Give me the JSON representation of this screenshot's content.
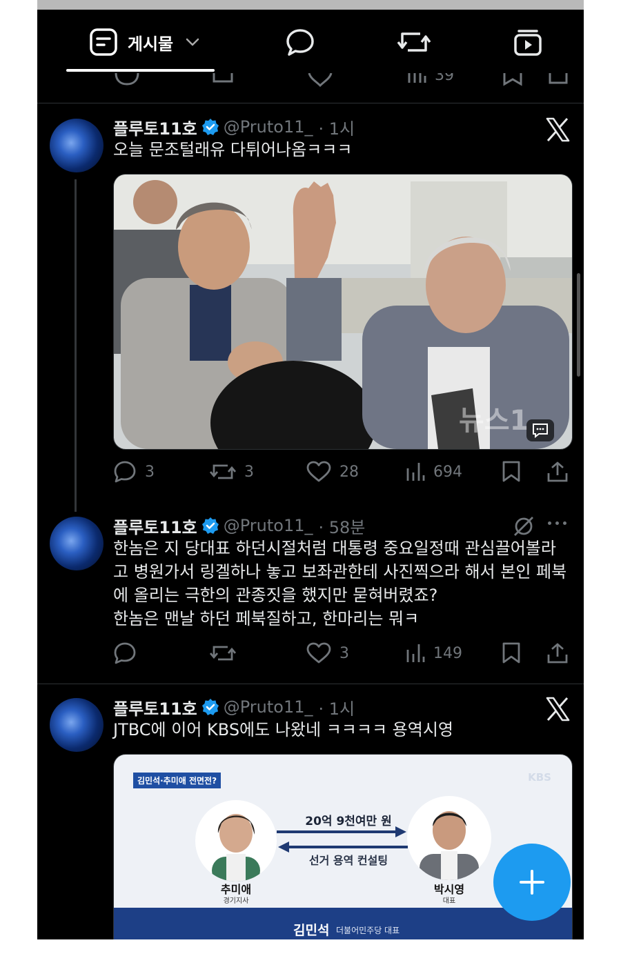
{
  "tabs": [
    {
      "label": "게시물",
      "icon": "posts-icon"
    },
    {
      "icon": "chat-bubble-icon"
    },
    {
      "icon": "repost-icon"
    },
    {
      "icon": "video-icon"
    }
  ],
  "prev_post": {
    "views": "39"
  },
  "posts": [
    {
      "name": "플루토11호",
      "handle": "@Pruto11_",
      "time": "· 1시",
      "text": "오늘 문조털래유 다튀어나옴ㅋㅋㅋ",
      "media_watermark": "뉴스1",
      "replies": "3",
      "reposts": "3",
      "likes": "28",
      "views": "694"
    },
    {
      "name": "플루토11호",
      "handle": "@Pruto11_",
      "time": "· 58분",
      "text": "한놈은 지 당대표 하던시절처럼 대통령 중요일정때 관심끌어볼라고 병원가서 링겔하나 놓고 보좌관한테 사진찍으라 해서 본인 페북에 올리는 극한의 관종짓을 했지만 묻혀버렸죠?\n한놈은 맨날 하던 페북질하고, 한마리는 뭐ㅋ",
      "replies": "",
      "reposts": "",
      "likes": "3",
      "views": "149"
    },
    {
      "name": "플루토11호",
      "handle": "@Pruto11_",
      "time": "· 1시",
      "text": "JTBC에 이어 KBS에도 나왔네 ㅋㅋㅋㅋ 용역시영",
      "card": {
        "tag": "김민석·추미애 전면전?",
        "brand": "KBS",
        "arrow_top": "20억 9천여만 원",
        "arrow_bottom": "선거 용역 컨설팅",
        "left_name": "추미애",
        "left_role": "경기지사",
        "right_name": "박시영",
        "right_role": "대표",
        "footer_name": "김민석",
        "footer_role": "더불어민주당 대표"
      }
    }
  ],
  "colors": {
    "accent": "#1d9bf0",
    "muted": "#71767b",
    "text": "#e7e9ea",
    "bg": "#000000"
  }
}
